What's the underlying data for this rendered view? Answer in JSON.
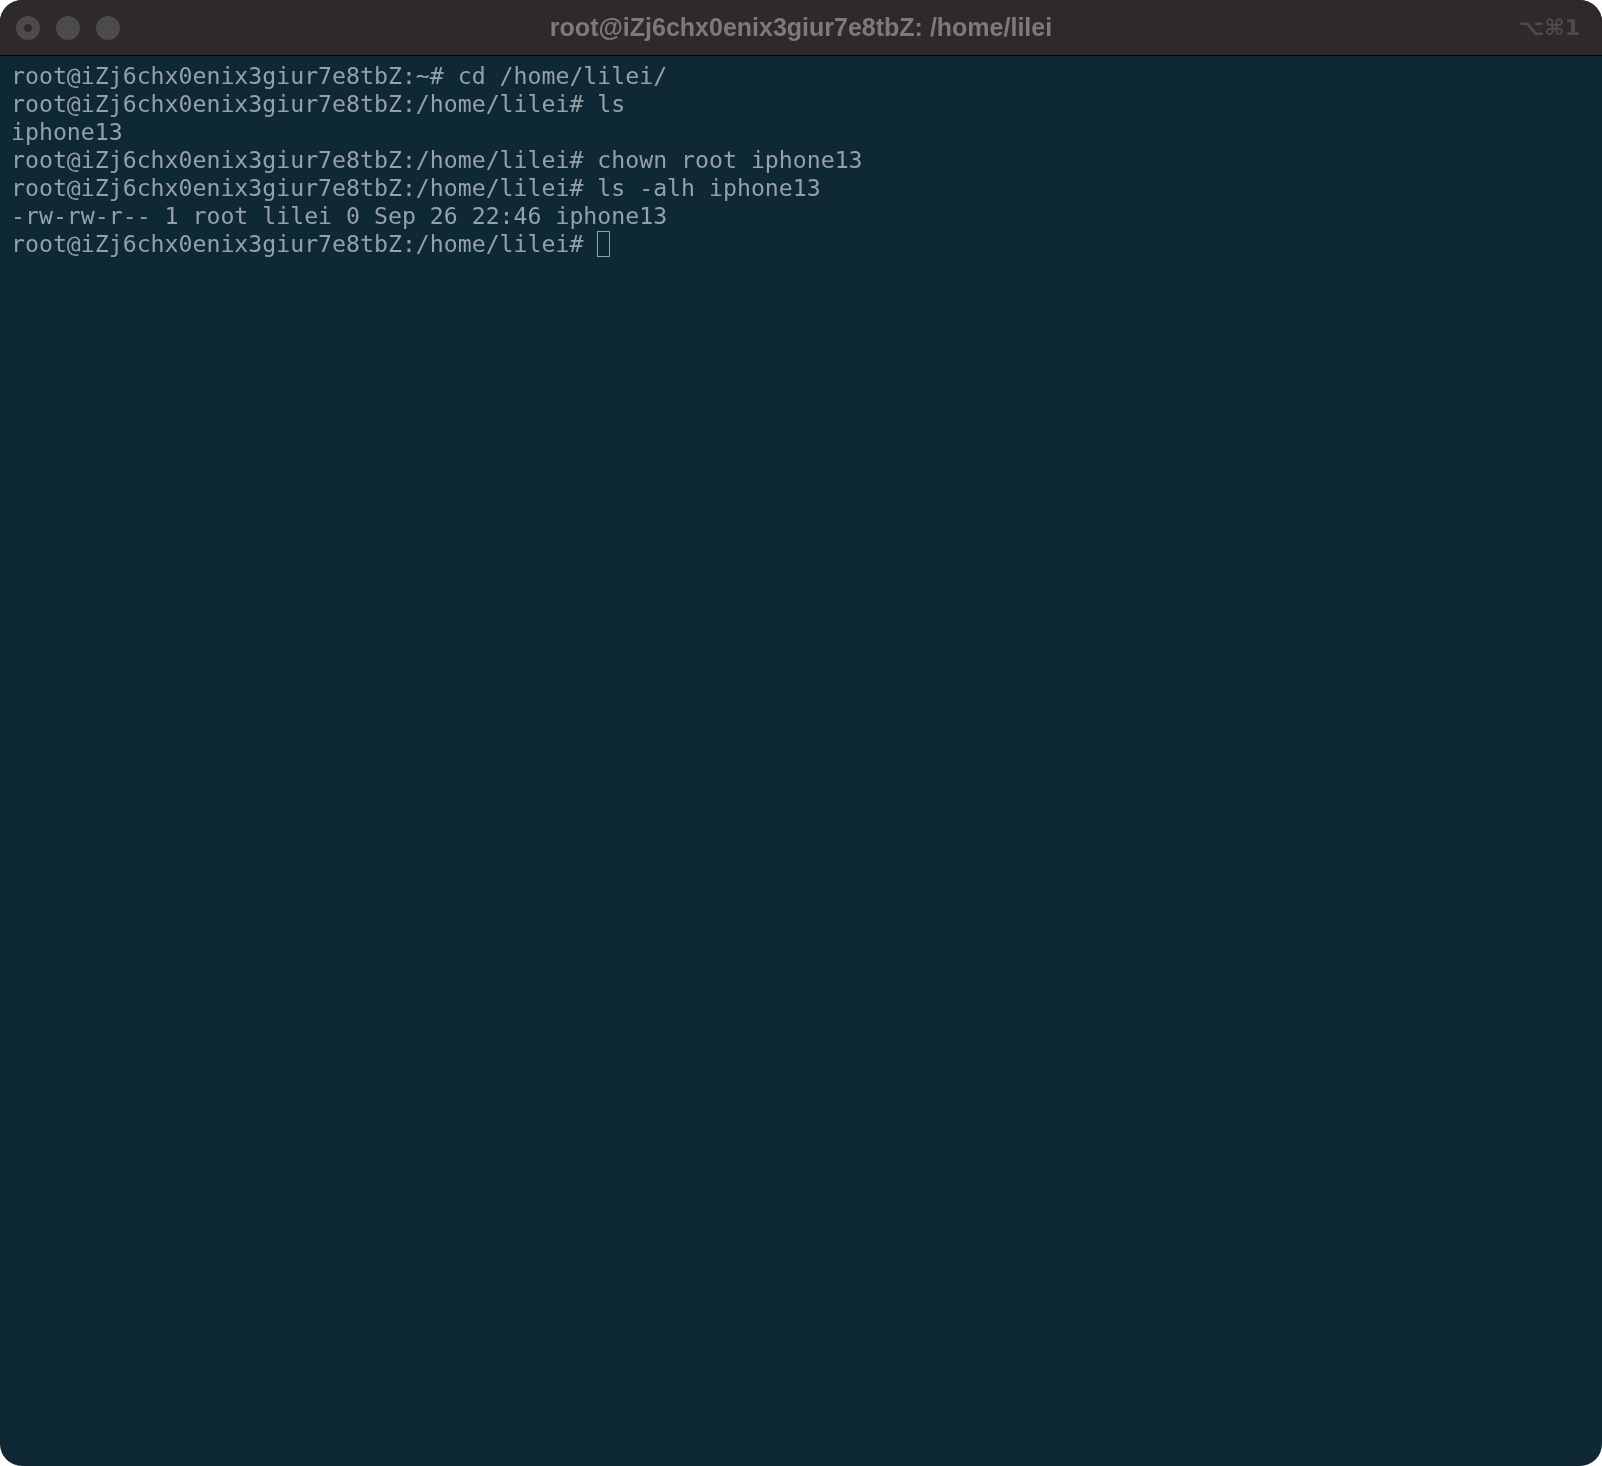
{
  "window": {
    "title": "root@iZj6chx0enix3giur7e8tbZ: /home/lilei",
    "shortcut": "⌥⌘1",
    "focused": false
  },
  "terminal": {
    "lines": [
      {
        "text": "root@iZj6chx0enix3giur7e8tbZ:~# cd /home/lilei/"
      },
      {
        "text": "root@iZj6chx0enix3giur7e8tbZ:/home/lilei# ls"
      },
      {
        "text": "iphone13"
      },
      {
        "text": "root@iZj6chx0enix3giur7e8tbZ:/home/lilei# chown root iphone13"
      },
      {
        "text": "root@iZj6chx0enix3giur7e8tbZ:/home/lilei# ls -alh iphone13"
      },
      {
        "text": "-rw-rw-r-- 1 root lilei 0 Sep 26 22:46 iphone13"
      },
      {
        "text": "root@iZj6chx0enix3giur7e8tbZ:/home/lilei# ",
        "cursor": true
      }
    ]
  }
}
